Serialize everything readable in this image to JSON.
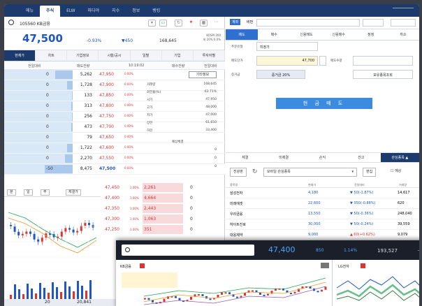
{
  "top_tabs": [
    "메뉴",
    "주식",
    "ELW",
    "파다야",
    "지수",
    "정보",
    "뱅킹"
  ],
  "active_top_tab": "주식",
  "stock": {
    "code_name": "105560 KB금융",
    "price": "47,500",
    "change_pct": "-0.93%",
    "change_amt": "▼450",
    "volume": "168,645",
    "side_lines": [
      "KOSPI 200",
      "외 20% 6.0%"
    ]
  },
  "left_tabs": [
    "현재가",
    "차트",
    "기업정보",
    "시황/공시",
    "일별",
    "기업",
    "투자자별"
  ],
  "orderbook_header": {
    "left": "전일대비",
    "mid": "매도잔량",
    "time": "10:19:02",
    "right": "매수잔량",
    "far": "전일대비"
  },
  "asks": [
    {
      "qty": "0",
      "vol": "5,262",
      "price": "47,950",
      "pct": "0.00%",
      "bar": 0.62
    },
    {
      "qty": "0",
      "vol": "1,728",
      "price": "47,900",
      "pct": "0.00%",
      "bar": 0.2
    },
    {
      "qty": "0",
      "vol": "133",
      "price": "47,850",
      "pct": "0.00%",
      "bar": 0.02
    },
    {
      "qty": "0",
      "vol": "313",
      "price": "47,800",
      "pct": "0.00%",
      "bar": 0.04
    },
    {
      "qty": "0",
      "vol": "256",
      "price": "47,750",
      "pct": "0.00%",
      "bar": 0.03
    },
    {
      "qty": "0",
      "vol": "473",
      "price": "47,700",
      "pct": "0.00%",
      "bar": 0.06
    },
    {
      "qty": "0",
      "vol": "79",
      "price": "47,650",
      "pct": "0.00%",
      "bar": 0.01
    },
    {
      "qty": "0",
      "vol": "1,722",
      "price": "47,600",
      "pct": "0.00%",
      "bar": 0.2
    },
    {
      "qty": "0",
      "vol": "2,270",
      "price": "47,550",
      "pct": "0.00%",
      "bar": 0.27
    },
    {
      "qty": "-50",
      "vol": "8,475",
      "price": "47,500",
      "pct": "0.00%",
      "bar": 1.0
    }
  ],
  "info_panel": {
    "button": "기타정보",
    "rows": [
      {
        "label": "거래량",
        "value": "168,645"
      },
      {
        "label": "회전율(%)",
        "value": "63.71%"
      },
      {
        "label": "시가",
        "value": "47,950"
      },
      {
        "label": "고가",
        "value": "48,000"
      },
      {
        "label": "저가",
        "value": "47,000"
      },
      {
        "label": "상한",
        "value": "61,650"
      },
      {
        "label": "하한",
        "value": "33,400"
      }
    ],
    "sub_title": "예상체결",
    "sub_rows": [
      {
        "label": "",
        "value": "0"
      },
      {
        "label": "",
        "value": "0"
      },
      {
        "label": "",
        "value": "0"
      }
    ]
  },
  "bids": [
    {
      "price": "47,450",
      "pct": "1.00%",
      "vol": "2,261",
      "zero": "0"
    },
    {
      "price": "47,400",
      "pct": "1.00%",
      "vol": "4,664",
      "zero": "0"
    },
    {
      "price": "47,350",
      "pct": "1.00%",
      "vol": "2,443",
      "zero": "0"
    },
    {
      "price": "47,300",
      "pct": "1.00%",
      "vol": "1,063",
      "zero": "0"
    },
    {
      "price": "47,250",
      "pct": "1.00%",
      "vol": "351",
      "zero": "0"
    }
  ],
  "chart_toolbar": [
    "분",
    "일",
    "주",
    "체결가"
  ],
  "bottom_left": {
    "total_bid": "20",
    "total_ask": "20,841"
  },
  "order_tabs": [
    "매도",
    "매수",
    "신용매도",
    "신용매수",
    "정정",
    "취소"
  ],
  "active_order_tab": "매도",
  "order_top": {
    "account": "계좌",
    "pw": "비번"
  },
  "order_form": {
    "type_label": "주문유형",
    "type_value": "지정가",
    "qty_label": "매도단가",
    "price_value": "47,700",
    "qty2_label": "매도수량",
    "amount_label": "증거금",
    "amount_value": "증거금 20%",
    "rate_button": "보유종목조회",
    "sell_button": "현 금 매 도"
  },
  "bottom_tabs": [
    "체결",
    "미체결",
    "손익",
    "잔고",
    "관심종목"
  ],
  "active_bottom_tab": "관심종목",
  "fav_bar": {
    "edit": "전광판",
    "group": "모바일 관심종목",
    "btn": "편집",
    "check": "예상"
  },
  "fav_header": [
    "종목명",
    "현재가",
    "전일대비",
    "거래량"
  ],
  "favorites": [
    {
      "name": "삼성전자",
      "price": "4,180",
      "chg": "▼ 50(-1.87%)",
      "vol": "14,617"
    },
    {
      "name": "미래에셋",
      "price": "22,600",
      "chg": "▼ 350(-0.88%)",
      "vol": "620"
    },
    {
      "name": "우리금융",
      "price": "13,550",
      "chg": "▼ 50(-0.36%)",
      "vol": "248,040"
    },
    {
      "name": "하이트진로",
      "price": "30,000",
      "chg": "▼ 50(-0.24%)",
      "vol": "39,559"
    },
    {
      "name": "대웅제약",
      "price": "9,000",
      "chg": "▲ 60(+0.62%)",
      "vol": "9,079"
    }
  ],
  "overlay": {
    "price": "47,400",
    "change": "850",
    "pct": "1.14%",
    "volume": "193,527",
    "panelA_tag": "KB금융",
    "panelB_tag": "LG전자"
  },
  "colors": {
    "navy": "#1c3a6b",
    "up": "#d33",
    "down": "#1e56c2",
    "accent": "#3b8be0"
  }
}
